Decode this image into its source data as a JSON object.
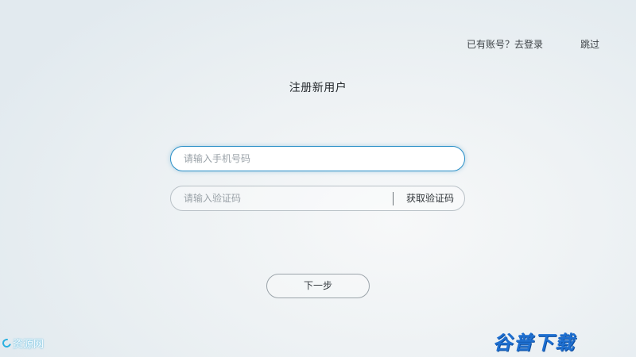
{
  "header": {
    "login_link": "已有账号？去登录",
    "skip_link": "跳过"
  },
  "title": "注册新用户",
  "form": {
    "phone": {
      "value": "",
      "placeholder": "请输入手机号码"
    },
    "code": {
      "value": "",
      "placeholder": "请输入验证码",
      "get_code_label": "获取验证码"
    },
    "next_label": "下一步"
  },
  "watermarks": {
    "left_text": "资源网",
    "right_text": "谷普下载"
  },
  "colors": {
    "focus_border": "#2a8fc7",
    "field_border": "#b9c1c7",
    "watermark_blue": "#1e6fd0"
  }
}
